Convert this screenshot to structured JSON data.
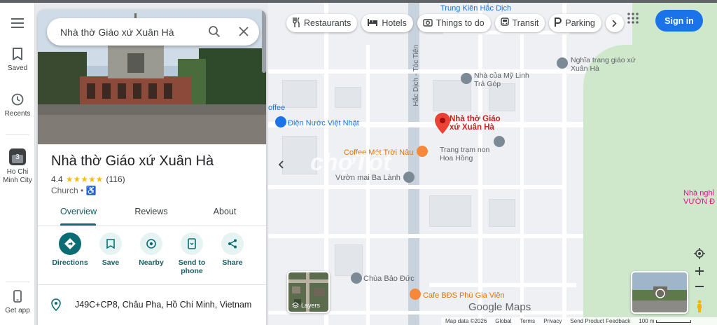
{
  "search": {
    "value": "Nhà thờ Giáo xứ Xuân Hà"
  },
  "rail": {
    "saved_label": "Saved",
    "recents_label": "Recents",
    "recent_place_label": "Ho Chi Minh City",
    "recent_place_badge": "3",
    "get_app_label": "Get app"
  },
  "place": {
    "title": "Nhà thờ Giáo xứ Xuân Hà",
    "rating": "4.4",
    "stars": "★★★★★",
    "review_count": "(116)",
    "category": "Church",
    "accessible_symbol": "♿"
  },
  "tabs": [
    {
      "label": "Overview",
      "active": true
    },
    {
      "label": "Reviews",
      "active": false
    },
    {
      "label": "About",
      "active": false
    }
  ],
  "actions": [
    {
      "label": "Directions",
      "icon": "directions-icon"
    },
    {
      "label": "Save",
      "icon": "bookmark-icon"
    },
    {
      "label": "Nearby",
      "icon": "nearby-icon"
    },
    {
      "label": "Send to phone",
      "icon": "phone-icon"
    },
    {
      "label": "Share",
      "icon": "share-icon"
    }
  ],
  "address": "J49C+CP8, Châu Pha, Hồ Chí Minh, Vietnam",
  "chips": [
    {
      "label": "Restaurants",
      "icon": "restaurant-icon"
    },
    {
      "label": "Hotels",
      "icon": "hotel-icon"
    },
    {
      "label": "Things to do",
      "icon": "camera-icon"
    },
    {
      "label": "Transit",
      "icon": "transit-icon"
    },
    {
      "label": "Parking",
      "icon": "parking-icon"
    }
  ],
  "signin_label": "Sign in",
  "map": {
    "labels": {
      "top_poi": "Trung Kiên Hắc Dịch",
      "road": "Hắc Dịch - Tóc Tiên",
      "cemetery": "Nghĩa trang giáo xứ Xuân Hà",
      "shop": "Nhà của Mỹ Linh Trả Góp",
      "water": "Điện Nước Việt Nhật",
      "coffee_left": "offee",
      "selected": "Nhà thờ Giáo xứ Xuân Hà",
      "garden": "Vườn mai Ba Lành",
      "coffee": "Coffee Mát Trời Nâu",
      "rose": "Trang trạm non Hoa Hồng",
      "pagoda": "Chùa Bảo Đức",
      "cafe_bds": "Cafe BĐS Phú Gia Viên",
      "right_place": "Nhà nghỉ VƯỜN Đ",
      "watermark": "chợTốt"
    },
    "layers_label": "Layers",
    "logo_text": "Google Maps",
    "footer": [
      "Map data ©2026",
      "Global",
      "Terms",
      "Privacy",
      "Send Product Feedback",
      "100 m"
    ],
    "colors": {
      "accent": "#0b6d73",
      "pin": "#ea4335",
      "signin": "#1a73e8"
    }
  }
}
